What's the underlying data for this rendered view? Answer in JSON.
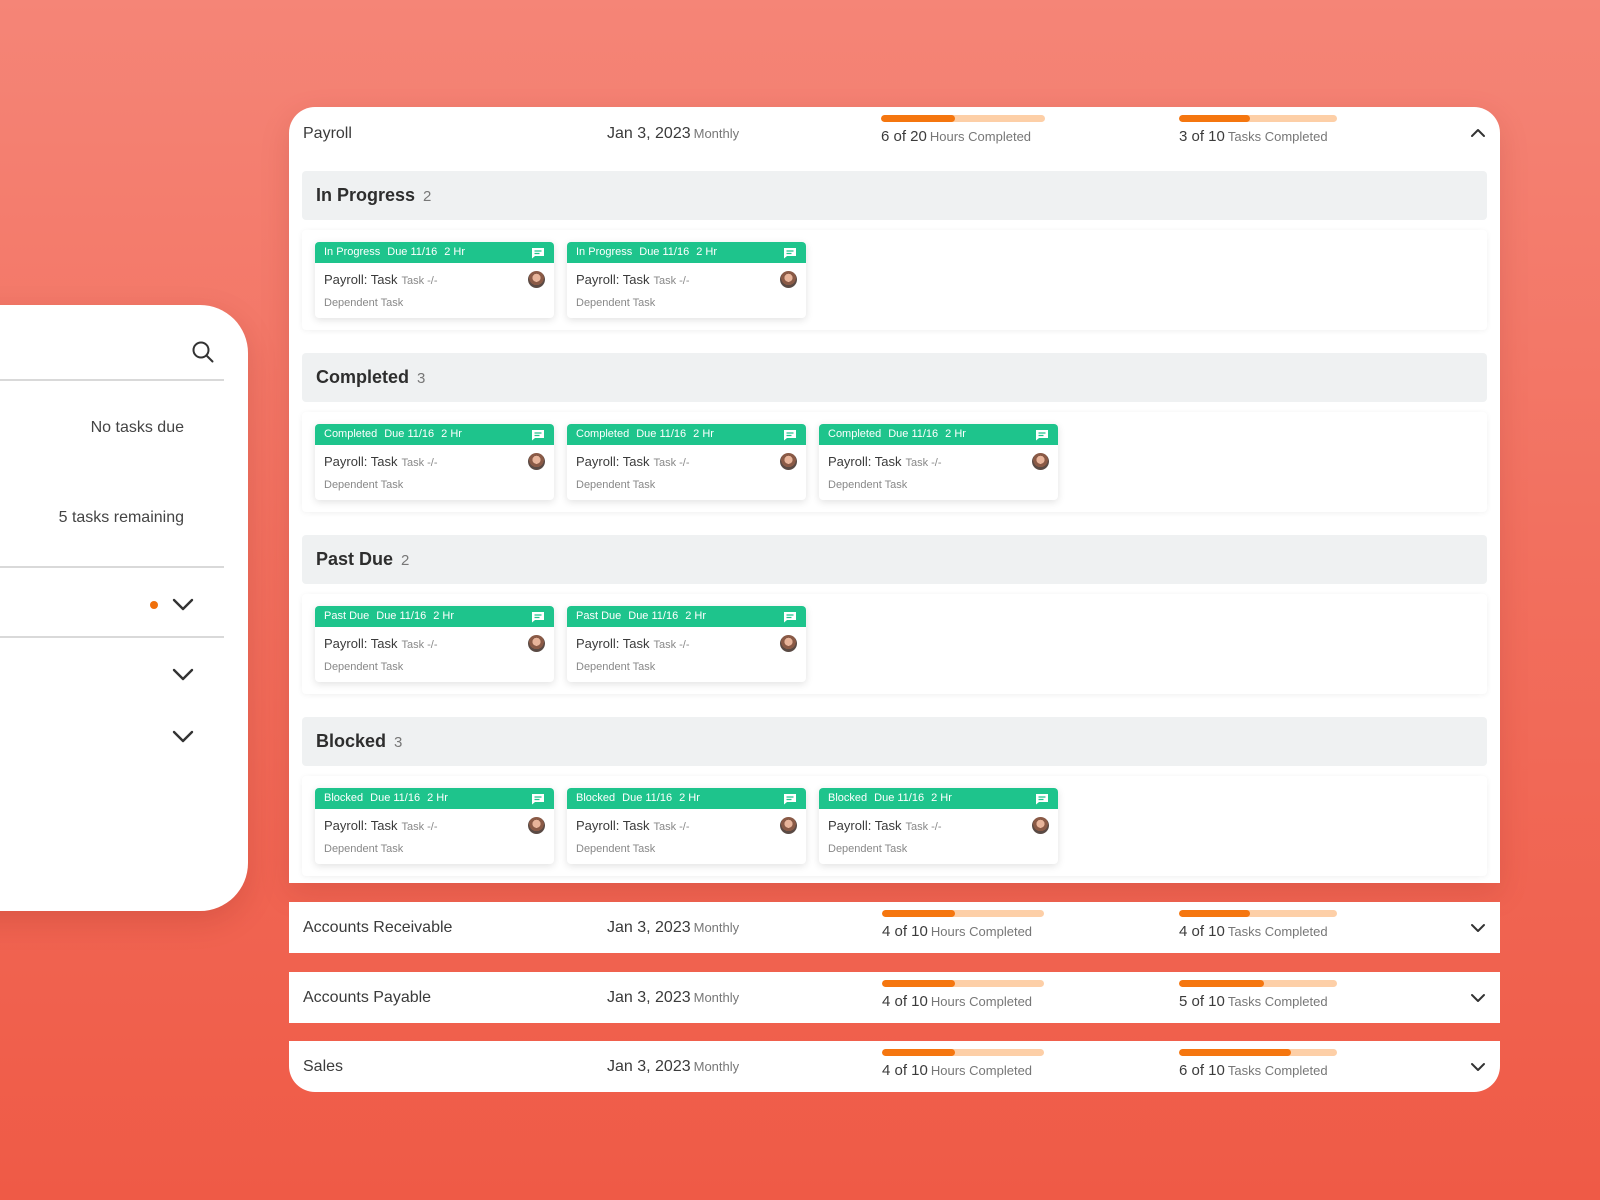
{
  "side_panel": {
    "search_icon": "search-icon",
    "no_tasks_text": "No tasks due",
    "remaining_text": "5 tasks remaining",
    "accent_color": "#f0700c"
  },
  "payroll": {
    "name": "Payroll",
    "date": "Jan 3, 2023",
    "frequency": "Monthly",
    "hours": {
      "value": "6 of 20",
      "label": "Hours Completed",
      "progress": 0.45
    },
    "tasks": {
      "value": "3 of 10",
      "label": "Tasks Completed",
      "progress": 0.45
    },
    "sections": [
      {
        "title": "In Progress",
        "count": "2",
        "cards": [
          {
            "status": "In Progress",
            "due": "Due 11/16",
            "hours": "2 Hr",
            "title": "Payroll: Task",
            "tag": "Task -/-",
            "sub": "Dependent Task"
          },
          {
            "status": "In Progress",
            "due": "Due 11/16",
            "hours": "2 Hr",
            "title": "Payroll: Task",
            "tag": "Task -/-",
            "sub": "Dependent Task"
          }
        ]
      },
      {
        "title": "Completed",
        "count": "3",
        "cards": [
          {
            "status": "Completed",
            "due": "Due 11/16",
            "hours": "2 Hr",
            "title": "Payroll: Task",
            "tag": "Task -/-",
            "sub": "Dependent Task"
          },
          {
            "status": "Completed",
            "due": "Due 11/16",
            "hours": "2 Hr",
            "title": "Payroll: Task",
            "tag": "Task -/-",
            "sub": "Dependent Task"
          },
          {
            "status": "Completed",
            "due": "Due 11/16",
            "hours": "2 Hr",
            "title": "Payroll: Task",
            "tag": "Task -/-",
            "sub": "Dependent Task"
          }
        ]
      },
      {
        "title": "Past Due",
        "count": "2",
        "cards": [
          {
            "status": "Past Due",
            "due": "Due 11/16",
            "hours": "2 Hr",
            "title": "Payroll: Task",
            "tag": "Task -/-",
            "sub": "Dependent Task"
          },
          {
            "status": "Past Due",
            "due": "Due 11/16",
            "hours": "2 Hr",
            "title": "Payroll: Task",
            "tag": "Task -/-",
            "sub": "Dependent Task"
          }
        ]
      },
      {
        "title": "Blocked",
        "count": "3",
        "cards": [
          {
            "status": "Blocked",
            "due": "Due 11/16",
            "hours": "2 Hr",
            "title": "Payroll: Task",
            "tag": "Task -/-",
            "sub": "Dependent Task"
          },
          {
            "status": "Blocked",
            "due": "Due 11/16",
            "hours": "2 Hr",
            "title": "Payroll: Task",
            "tag": "Task -/-",
            "sub": "Dependent Task"
          },
          {
            "status": "Blocked",
            "due": "Due 11/16",
            "hours": "2 Hr",
            "title": "Payroll: Task",
            "tag": "Task -/-",
            "sub": "Dependent Task"
          }
        ]
      }
    ]
  },
  "collapsed_rows": [
    {
      "name": "Accounts Receivable",
      "date": "Jan 3, 2023",
      "frequency": "Monthly",
      "hours": {
        "value": "4 of 10",
        "label": "Hours Completed",
        "progress": 0.45
      },
      "tasks": {
        "value": "4 of 10",
        "label": "Tasks Completed",
        "progress": 0.45
      }
    },
    {
      "name": "Accounts Payable",
      "date": "Jan 3, 2023",
      "frequency": "Monthly",
      "hours": {
        "value": "4 of 10",
        "label": "Hours Completed",
        "progress": 0.45
      },
      "tasks": {
        "value": "5 of 10",
        "label": "Tasks Completed",
        "progress": 0.54
      }
    },
    {
      "name": "Sales",
      "date": "Jan 3, 2023",
      "frequency": "Monthly",
      "hours": {
        "value": "4 of 10",
        "label": "Hours Completed",
        "progress": 0.45
      },
      "tasks": {
        "value": "6 of 10",
        "label": "Tasks Completed",
        "progress": 0.71
      }
    }
  ],
  "colors": {
    "card_header": "#1ec48c",
    "progress_fill": "#f5760f",
    "progress_track": "#fdcfa7"
  }
}
